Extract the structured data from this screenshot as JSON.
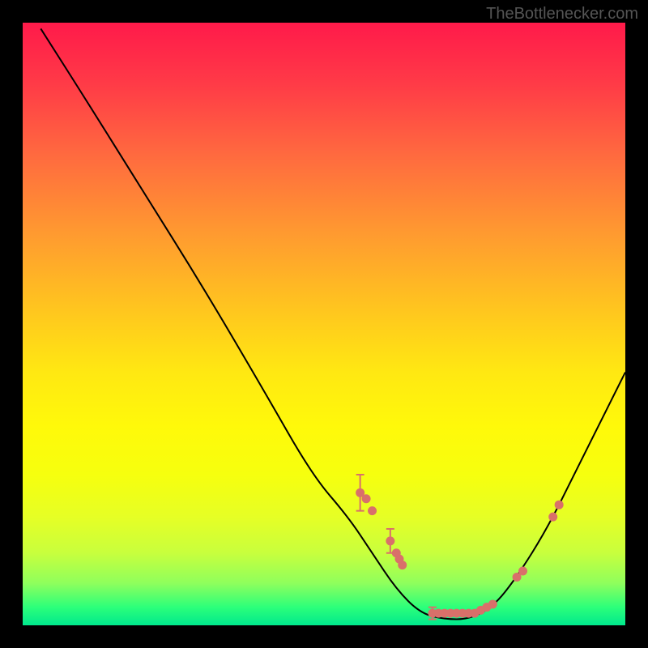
{
  "watermark": "TheBottlenecker.com",
  "chart_data": {
    "type": "line",
    "title": "",
    "xlabel": "",
    "ylabel": "",
    "xlim": [
      0,
      100
    ],
    "ylim": [
      0,
      100
    ],
    "curve": [
      {
        "x": 3,
        "y": 99
      },
      {
        "x": 10,
        "y": 88
      },
      {
        "x": 20,
        "y": 72
      },
      {
        "x": 30,
        "y": 56
      },
      {
        "x": 40,
        "y": 39
      },
      {
        "x": 48,
        "y": 25
      },
      {
        "x": 54,
        "y": 18
      },
      {
        "x": 58,
        "y": 12
      },
      {
        "x": 62,
        "y": 6
      },
      {
        "x": 66,
        "y": 2
      },
      {
        "x": 70,
        "y": 1
      },
      {
        "x": 74,
        "y": 1
      },
      {
        "x": 78,
        "y": 3
      },
      {
        "x": 82,
        "y": 8
      },
      {
        "x": 87,
        "y": 16
      },
      {
        "x": 92,
        "y": 26
      },
      {
        "x": 97,
        "y": 36
      },
      {
        "x": 100,
        "y": 42
      }
    ],
    "markers": [
      {
        "x": 56,
        "y": 22,
        "err": 3
      },
      {
        "x": 57,
        "y": 21,
        "err": 0
      },
      {
        "x": 58,
        "y": 19,
        "err": 0
      },
      {
        "x": 61,
        "y": 14,
        "err": 2
      },
      {
        "x": 62,
        "y": 12,
        "err": 0
      },
      {
        "x": 62.5,
        "y": 11,
        "err": 0
      },
      {
        "x": 63,
        "y": 10,
        "err": 0
      },
      {
        "x": 68,
        "y": 2,
        "err": 1
      },
      {
        "x": 69,
        "y": 2,
        "err": 0
      },
      {
        "x": 70,
        "y": 2,
        "err": 0
      },
      {
        "x": 71,
        "y": 2,
        "err": 0
      },
      {
        "x": 72,
        "y": 2,
        "err": 0
      },
      {
        "x": 73,
        "y": 2,
        "err": 0
      },
      {
        "x": 74,
        "y": 2,
        "err": 0
      },
      {
        "x": 75,
        "y": 2,
        "err": 0
      },
      {
        "x": 76,
        "y": 2.5,
        "err": 0
      },
      {
        "x": 77,
        "y": 3,
        "err": 0
      },
      {
        "x": 78,
        "y": 3.5,
        "err": 0
      },
      {
        "x": 82,
        "y": 8,
        "err": 0
      },
      {
        "x": 83,
        "y": 9,
        "err": 0
      },
      {
        "x": 88,
        "y": 18,
        "err": 0
      },
      {
        "x": 89,
        "y": 20,
        "err": 0
      }
    ],
    "gradient_stops": [
      {
        "offset": 0,
        "color": "#ff1a4a"
      },
      {
        "offset": 50,
        "color": "#ffe812"
      },
      {
        "offset": 100,
        "color": "#00e98d"
      }
    ]
  }
}
